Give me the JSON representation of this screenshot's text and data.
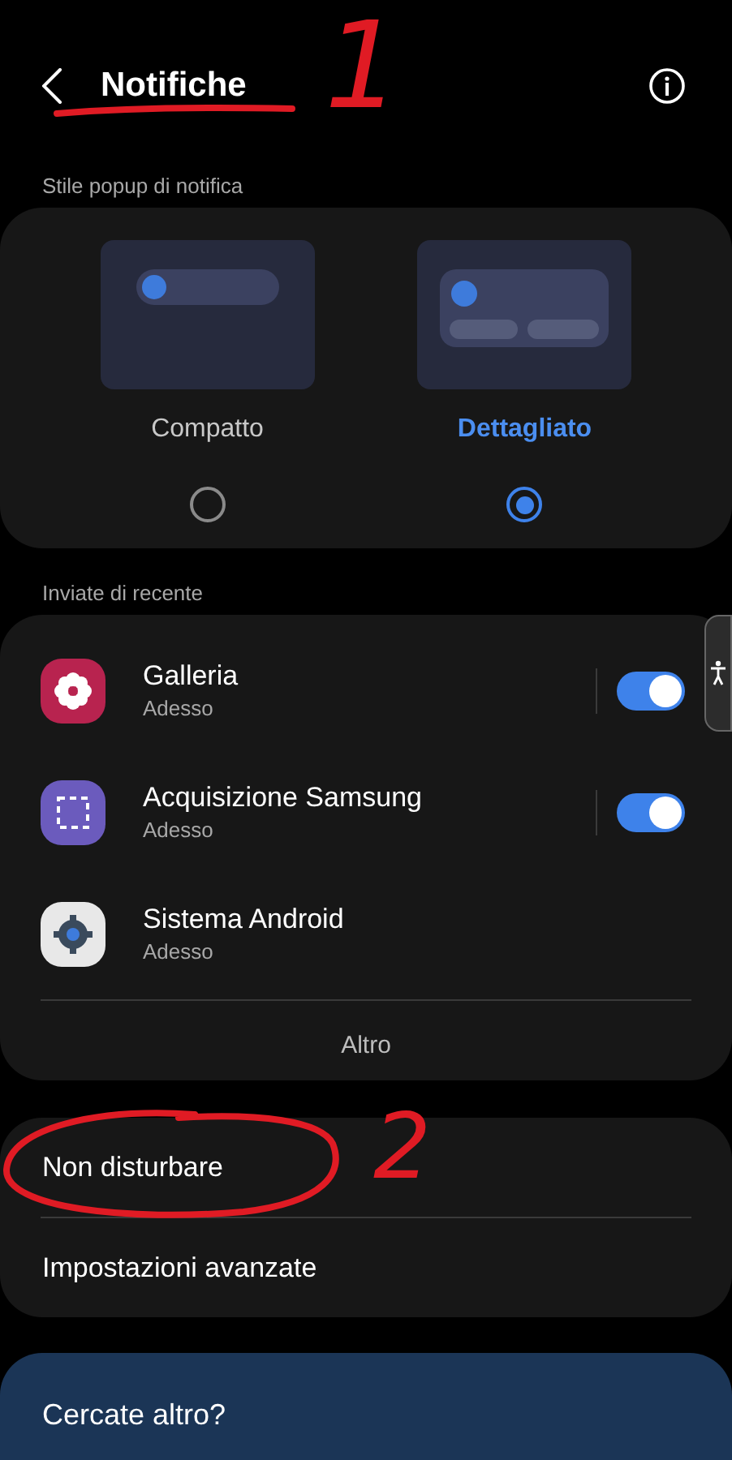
{
  "header": {
    "title": "Notifiche"
  },
  "popup_style": {
    "label": "Stile popup di notifica",
    "options": [
      {
        "kind": "compact",
        "label": "Compatto",
        "selected": false
      },
      {
        "kind": "detailed",
        "label": "Dettagliato",
        "selected": true
      }
    ]
  },
  "recent": {
    "label": "Inviate di recente",
    "apps": [
      {
        "kind": "gallery",
        "name": "Galleria",
        "time": "Adesso",
        "on": true
      },
      {
        "kind": "capture",
        "name": "Acquisizione Samsung",
        "time": "Adesso",
        "on": true
      },
      {
        "kind": "android",
        "name": "Sistema Android",
        "time": "Adesso"
      }
    ],
    "more": "Altro"
  },
  "settings": [
    "Non disturbare",
    "Impostazioni avanzate"
  ],
  "promo": "Cercate altro?",
  "annotations": [
    {
      "kind": "underline"
    },
    {
      "kind": "number",
      "label": "1"
    },
    {
      "kind": "ellipse"
    },
    {
      "kind": "number",
      "label": "2"
    }
  ]
}
